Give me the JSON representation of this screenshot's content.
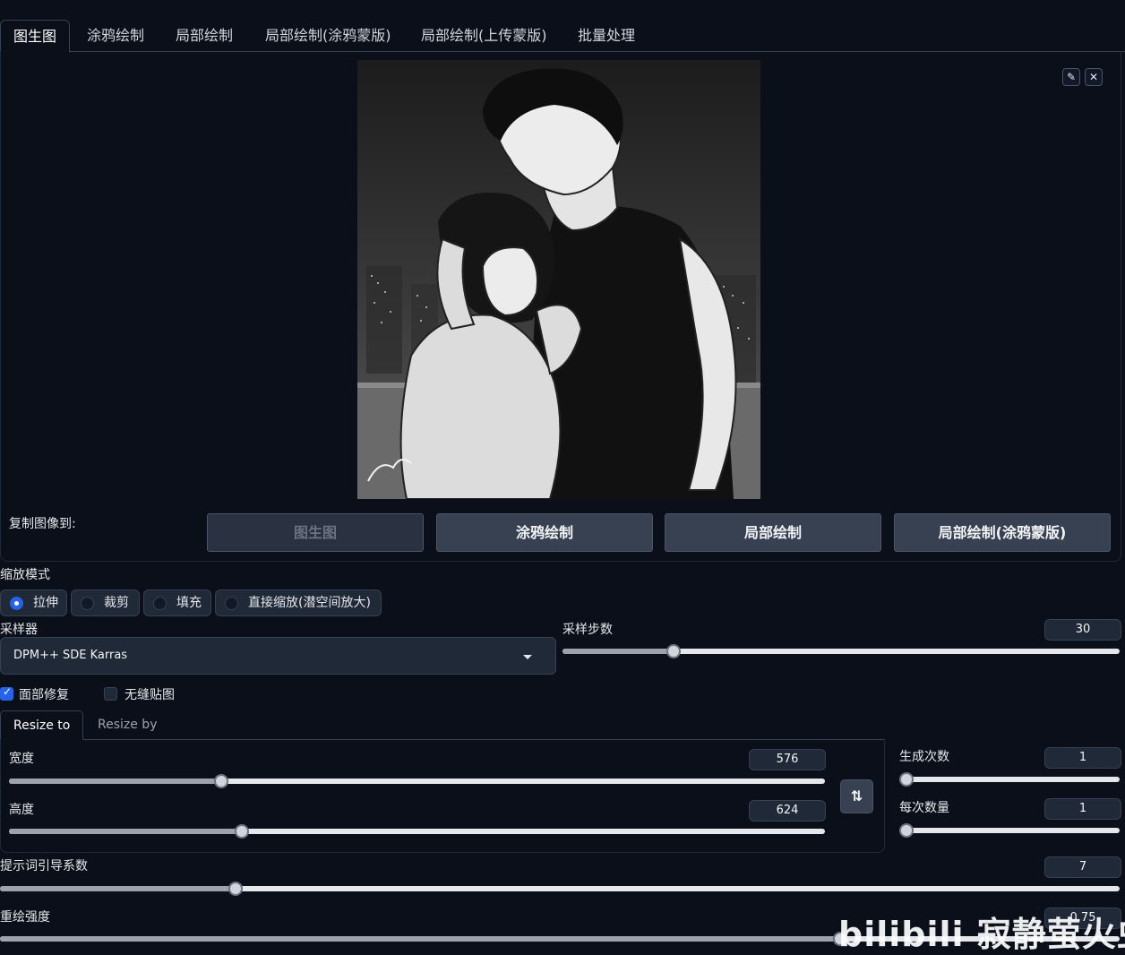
{
  "tabs": [
    {
      "label": "图生图",
      "active": true
    },
    {
      "label": "涂鸦绘制"
    },
    {
      "label": "局部绘制"
    },
    {
      "label": "局部绘制(涂鸦蒙版)"
    },
    {
      "label": "局部绘制(上传蒙版)"
    },
    {
      "label": "批量处理"
    }
  ],
  "image_tools": {
    "edit_icon": "pencil-icon",
    "close_icon": "close-icon"
  },
  "copy_to": {
    "label": "复制图像到:",
    "buttons": [
      "图生图",
      "涂鸦绘制",
      "局部绘制",
      "局部绘制(涂鸦蒙版)"
    ]
  },
  "resize_mode": {
    "label": "缩放模式",
    "options": [
      "拉伸",
      "裁剪",
      "填充",
      "直接缩放(潜空间放大)"
    ],
    "selected": "拉伸"
  },
  "sampler": {
    "label": "采样器",
    "value": "DPM++ SDE Karras"
  },
  "sampling_steps": {
    "label": "采样步数",
    "value": "30",
    "fraction": 0.2
  },
  "checkboxes": [
    {
      "label": "面部修复",
      "checked": true
    },
    {
      "label": "无缝贴图",
      "checked": false
    }
  ],
  "resize_tabs": [
    "Resize to",
    "Resize by"
  ],
  "width": {
    "label": "宽度",
    "value": "576",
    "fraction": 0.26
  },
  "height": {
    "label": "高度",
    "value": "624",
    "fraction": 0.285
  },
  "swap_icon": "swap-arrows-icon",
  "batch_count": {
    "label": "生成次数",
    "value": "1",
    "fraction": 0.0
  },
  "batch_size": {
    "label": "每次数量",
    "value": "1",
    "fraction": 0.0
  },
  "cfg_scale": {
    "label": "提示词引导系数",
    "value": "7",
    "fraction": 0.21
  },
  "denoising": {
    "label": "重绘强度",
    "value": "0.75",
    "fraction": 0.75
  },
  "watermark": "bilibili 寂静萤火虫",
  "colors": {
    "background": "#0b0f19",
    "accent": "#2563eb",
    "panel": "#1f2937"
  }
}
